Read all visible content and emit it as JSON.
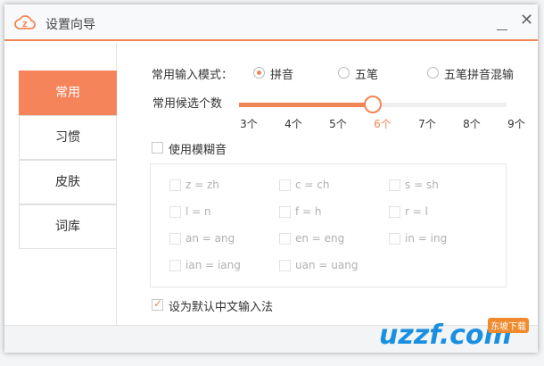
{
  "window": {
    "title": "设置向导",
    "minimize_label": "minimize",
    "close_glyph": "✕"
  },
  "sidebar": {
    "items": [
      {
        "label": "常用",
        "active": true
      },
      {
        "label": "习惯"
      },
      {
        "label": "皮肤"
      },
      {
        "label": "词库"
      }
    ]
  },
  "input_mode": {
    "label": "常用输入模式：",
    "options": [
      "拼音",
      "五笔",
      "五笔拼音混输"
    ],
    "selected": "拼音"
  },
  "candidates": {
    "label": "常用候选个数",
    "ticks": [
      "3个",
      "4个",
      "5个",
      "6个",
      "7个",
      "8个",
      "9个"
    ],
    "selected_index": 3,
    "fraction": 0.5
  },
  "fuzzy": {
    "label": "使用模糊音",
    "checked": false,
    "options": [
      "z = zh",
      "c = ch",
      "s = sh",
      "l = n",
      "f = h",
      "r = l",
      "an = ang",
      "en = eng",
      "in = ing",
      "ian = iang",
      "uan = uang"
    ]
  },
  "default_ime": {
    "label": "设为默认中文输入法",
    "checked": true
  },
  "watermark": {
    "text": "uzzf.com",
    "badge": "东坡下载"
  },
  "colors": {
    "accent": "#f08656"
  }
}
